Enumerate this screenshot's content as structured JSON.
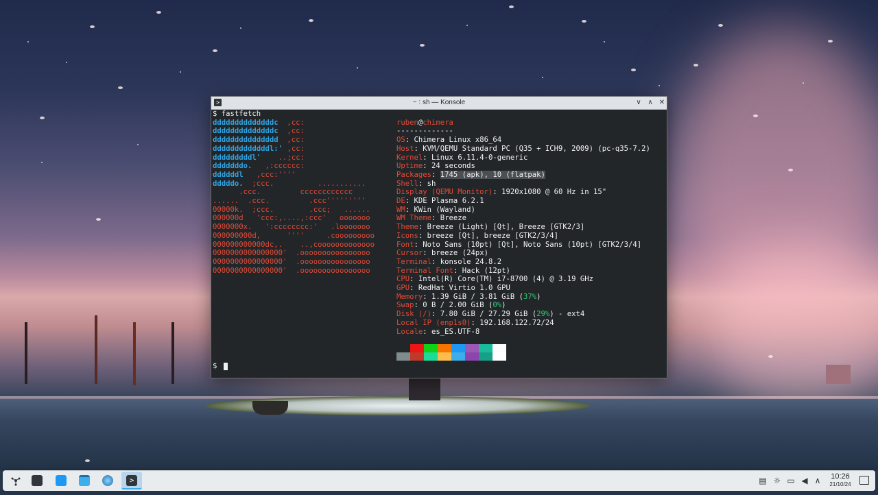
{
  "window": {
    "title": "~ : sh — Konsole",
    "app_icon": ">",
    "buttons": {
      "minimize": "∨",
      "maximize": "∧",
      "close": "✕"
    }
  },
  "terminal": {
    "command_line": "$ fastfetch",
    "logo_lines": [
      {
        "b": "ddddddddddddddc",
        "r": "  ,cc:"
      },
      {
        "b": "ddddddddddddddc",
        "r": "  ,cc:"
      },
      {
        "b": "ddddddddddddddd",
        "r": "  ,cc:"
      },
      {
        "b": "dddddddddddddl:'",
        "r": " ,cc:"
      },
      {
        "b": "dddddddddl'",
        "r": "    ..;cc:"
      },
      {
        "b": "dddddddo.",
        "r": "   ,:cccccc:"
      },
      {
        "b": "ddddddl",
        "r": "   ,ccc:''''"
      },
      {
        "b": "dddddo.",
        "r": "  ;ccc.          ..........."
      },
      {
        "b": "",
        "r": "      .ccc.         cccccccccccc"
      },
      {
        "b": "",
        "r": "......  .ccc.         .ccc'''''''''"
      },
      {
        "b": "",
        "r": "00000k.  ;ccc.        .ccc;   ......"
      },
      {
        "b": "",
        "r": "000000d   'ccc:,....,:ccc'   ooooooo"
      },
      {
        "b": "",
        "r": "0000000x.   ':cccccccc:'   .looooooo"
      },
      {
        "b": "",
        "r": "000000000d,      ''''     .cooooooooo"
      },
      {
        "b": "",
        "r": "000000000000dc,.    ..,cooooooooooooo"
      },
      {
        "b": "",
        "r": "0000000000000000'  .oooooooooooooooo"
      },
      {
        "b": "",
        "r": "0000000000000000'  .oooooooooooooooo"
      },
      {
        "b": "",
        "r": "0000000000000000'  .oooooooooooooooo"
      }
    ],
    "user": "ruben",
    "at": "@",
    "host": "chimera",
    "separator": "-------------",
    "info": [
      {
        "key": "OS",
        "value": "Chimera Linux x86_64"
      },
      {
        "key": "Host",
        "value": "KVM/QEMU Standard PC (Q35 + ICH9, 2009) (pc-q35-7.2)"
      },
      {
        "key": "Kernel",
        "value": "Linux 6.11.4-0-generic"
      },
      {
        "key": "Uptime",
        "value": "24 seconds"
      },
      {
        "key": "Packages",
        "value": "1745 (apk), 10 (flatpak)"
      },
      {
        "key": "Shell",
        "value": "sh"
      },
      {
        "key": "Display (QEMU Monitor)",
        "value": "1920x1080 @ 60 Hz in 15\""
      },
      {
        "key": "DE",
        "value": "KDE Plasma 6.2.1"
      },
      {
        "key": "WM",
        "value": "KWin (Wayland)"
      },
      {
        "key": "WM Theme",
        "value": "Breeze"
      },
      {
        "key": "Theme",
        "value": "Breeze (Light) [Qt], Breeze [GTK2/3]"
      },
      {
        "key": "Icons",
        "value": "breeze [Qt], breeze [GTK2/3/4]"
      },
      {
        "key": "Font",
        "value": "Noto Sans (10pt) [Qt], Noto Sans (10pt) [GTK2/3/4]"
      },
      {
        "key": "Cursor",
        "value": "breeze (24px)"
      },
      {
        "key": "Terminal",
        "value": "konsole 24.8.2"
      },
      {
        "key": "Terminal Font",
        "value": "Hack (12pt)"
      },
      {
        "key": "CPU",
        "value": "Intel(R) Core(TM) i7-8700 (4) @ 3.19 GHz"
      },
      {
        "key": "GPU",
        "value": "RedHat Virtio 1.0 GPU"
      },
      {
        "key": "Memory",
        "value": "1.39 GiB / 3.81 GiB (",
        "pct": "37%",
        "tail": ")"
      },
      {
        "key": "Swap",
        "value": "0 B / 2.00 GiB (",
        "pct": "0%",
        "tail": ")"
      },
      {
        "key": "Disk (/)",
        "value": "7.80 GiB / 27.29 GiB (",
        "pct": "29%",
        "tail": ") - ext4"
      },
      {
        "key": "Local IP (enp1s0)",
        "value": "192.168.122.72/24"
      },
      {
        "key": "Locale",
        "value": "es_ES.UTF-8"
      }
    ],
    "color_swatches_top": [
      "#232629",
      "#ed1515",
      "#11d116",
      "#f67400",
      "#1d99f3",
      "#9b59b6",
      "#1abc9c",
      "#fcfcfc"
    ],
    "color_swatches_bottom": [
      "#7f8c8d",
      "#c0392b",
      "#1cdc9a",
      "#fdbc4b",
      "#3daee9",
      "#8e44ad",
      "#16a085",
      "#ffffff"
    ],
    "prompt": "$"
  },
  "taskbar": {
    "items": [
      "application-launcher-icon",
      "system-settings-icon",
      "discover-store-icon",
      "file-manager-icon",
      "web-browser-icon",
      "konsole-icon"
    ],
    "tray": [
      "clipboard-icon",
      "brightness-icon",
      "display-icon",
      "volume-icon",
      "expand-tray-icon"
    ],
    "clock_time": "10:26",
    "clock_date": "21/10/24"
  }
}
